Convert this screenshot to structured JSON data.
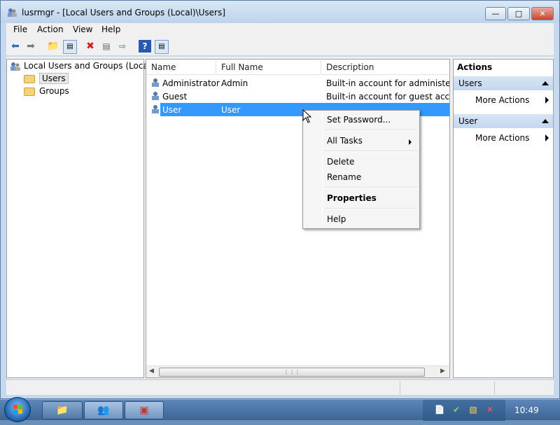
{
  "window": {
    "title": "lusrmgr - [Local Users and Groups (Local)\\Users]",
    "minimize_icon": "minimize-icon",
    "maximize_icon": "maximize-icon",
    "close_icon": "close-icon"
  },
  "menubar": {
    "items": [
      "File",
      "Action",
      "View",
      "Help"
    ]
  },
  "toolbar": {
    "icons": [
      "back-arrow-icon",
      "forward-arrow-icon",
      "up-folder-icon",
      "show-hide-tree-icon",
      "delete-icon",
      "properties-icon",
      "export-list-icon",
      "help-icon",
      "show-hide-action-pane-icon"
    ]
  },
  "tree": {
    "root": "Local Users and Groups (Local)",
    "children": [
      "Users",
      "Groups"
    ]
  },
  "list": {
    "columns": [
      "Name",
      "Full Name",
      "Description"
    ],
    "rows": [
      {
        "name": "Administrator",
        "full_name": "Admin",
        "description": "Built-in account for administering"
      },
      {
        "name": "Guest",
        "full_name": "",
        "description": "Built-in account for guest access t"
      },
      {
        "name": "User",
        "full_name": "User",
        "description": ""
      }
    ],
    "selected_row": 2
  },
  "actions": {
    "header": "Actions",
    "sections": [
      {
        "title": "Users",
        "items": [
          "More Actions"
        ]
      },
      {
        "title": "User",
        "items": [
          "More Actions"
        ]
      }
    ]
  },
  "context_menu": {
    "items": [
      "Set Password...",
      "All Tasks",
      "Delete",
      "Rename",
      "Properties",
      "Help"
    ]
  },
  "taskbar": {
    "clock": "10:49",
    "colors": {
      "selection": "#3399ff",
      "taskbar": "#4a76a8"
    }
  }
}
